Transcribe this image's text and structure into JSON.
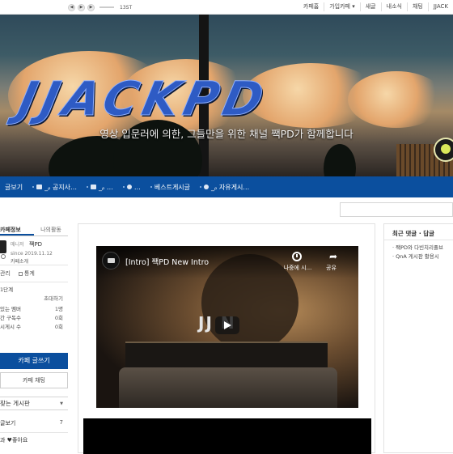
{
  "topbar": {
    "track_label": "13ST",
    "nav": [
      "카페홈",
      "가입카페 ▾",
      "새글",
      "내소식",
      "채팅",
      "JJACK"
    ]
  },
  "banner": {
    "logo_text": "JJACKPD",
    "slogan": "영상 입문러에 의한, 그들만을 위한 채널 짹PD가 함께합니다"
  },
  "menubar": {
    "items": [
      "글보기",
      "_ᵨ 공지사…",
      "_ᵨ …",
      "…",
      "베스트게시글",
      "_ᵨ 자유게시…"
    ]
  },
  "sidebar": {
    "tabs": [
      "카페정보",
      "나의활동"
    ],
    "profile": {
      "role": "매니저",
      "name": "짹PD",
      "since": "since 2019.11.12",
      "intro": "카페소개"
    },
    "admin": [
      "관리",
      "통계"
    ],
    "stats": {
      "level": "1단계",
      "invite": "초대하기",
      "rows": [
        {
          "label": "있는 멤버",
          "value": "1명"
        },
        {
          "label": "간 구독수",
          "value": "0회"
        },
        {
          "label": "시게시 수",
          "value": "0회"
        }
      ]
    },
    "write_button": "카페 글쓰기",
    "chat_button": "카페 채팅",
    "fav_boards": "찾는 게시판",
    "all_posts": {
      "label": "글보기",
      "count": "7"
    },
    "likes": "과 ♥좋아요"
  },
  "video": {
    "title": "[Intro] 짹PD New Intro",
    "watch_later": "나중에 시...",
    "share": "공유",
    "logo_overlay": "JJ   N"
  },
  "recent": {
    "title": "최근 댓글 · 답글",
    "items": [
      "· 짹PD와 다빈치리졸브",
      "· QnA 게시판 활용시"
    ]
  }
}
